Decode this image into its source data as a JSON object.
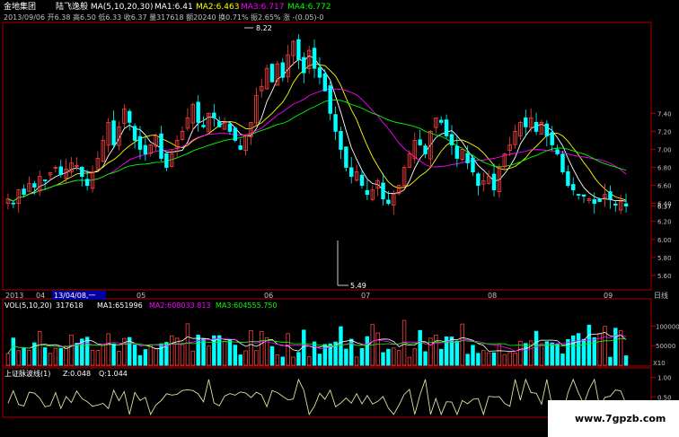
{
  "header": {
    "stock_name": "金地集团",
    "ma_label": "陆飞逸般 MA(5,10,20,30)",
    "ma1": "MA1:6.41",
    "ma2": "MA2:6.463",
    "ma3": "MA3:6.717",
    "ma4": "MA4:6.772",
    "info_line": "2013/09/06 开6.38 高6.50 低6.33 收6.37 量317618 额20240 换0.71% 振2.65% 涨 -(0.05)-0"
  },
  "price_labels": {
    "high": "8.22",
    "low": "5.49"
  },
  "x_axis": {
    "labels": [
      "2013",
      "04",
      "13/04/08,一",
      "05",
      "06",
      "07",
      "08",
      "09"
    ],
    "period": "日线"
  },
  "volume_panel": {
    "title": "VOL(5,10,20)",
    "value": "317618",
    "ma1": "MA1:651996",
    "ma2": "MA2:608033.813",
    "ma3": "MA3:604555.750",
    "unit": "X10"
  },
  "indicator_panel": {
    "title": "上证脉波线(1)",
    "z": "Z:0.048",
    "q": "Q:1.044"
  },
  "watermark": "www.7gpzb.com",
  "colors": {
    "background": "#000000",
    "up": "#ff4040",
    "down": "#00ffff",
    "ma1": "#ffffff",
    "ma2": "#ffff00",
    "ma3": "#ff00ff",
    "ma4": "#00ff00",
    "axis": "#b00000"
  },
  "chart_data": [
    {
      "type": "candlestick",
      "title": "",
      "y_ticks": [
        5.6,
        5.8,
        6.0,
        6.2,
        6.37,
        6.4,
        6.6,
        6.8,
        7.0,
        7.2,
        7.4
      ],
      "ylim": [
        5.45,
        8.4
      ],
      "close_series": [
        6.45,
        6.4,
        6.55,
        6.5,
        6.62,
        6.58,
        6.7,
        6.66,
        6.74,
        6.8,
        6.72,
        6.78,
        6.85,
        6.82,
        6.7,
        6.6,
        6.75,
        6.9,
        7.1,
        7.3,
        7.05,
        7.25,
        7.45,
        7.3,
        7.1,
        7.0,
        6.95,
        7.05,
        7.15,
        6.9,
        6.8,
        6.95,
        7.1,
        7.2,
        7.35,
        7.5,
        7.3,
        7.25,
        7.4,
        7.35,
        7.25,
        7.3,
        7.2,
        7.1,
        7.0,
        7.15,
        7.3,
        7.6,
        7.7,
        7.9,
        7.75,
        7.95,
        7.8,
        8.05,
        8.2,
        8.0,
        7.85,
        8.1,
        7.9,
        7.8,
        7.65,
        7.4,
        7.2,
        7.0,
        6.8,
        6.7,
        6.75,
        6.6,
        6.5,
        6.55,
        6.65,
        6.45,
        6.4,
        6.5,
        6.6,
        6.8,
        6.95,
        7.1,
        7.05,
        6.95,
        7.2,
        7.35,
        7.3,
        7.15,
        7.05,
        6.9,
        7.0,
        6.85,
        6.75,
        6.6,
        6.65,
        6.7,
        6.55,
        6.8,
        6.95,
        7.05,
        7.2,
        7.3,
        7.25,
        7.35,
        7.2,
        7.3,
        7.15,
        7.05,
        6.95,
        6.75,
        6.6,
        6.55,
        6.5,
        6.48,
        6.45,
        6.4,
        6.42,
        6.5,
        6.45,
        6.38,
        6.42,
        6.37
      ],
      "lines": [
        "MA1",
        "MA2",
        "MA3",
        "MA4"
      ]
    },
    {
      "type": "bar",
      "title": "",
      "y_ticks": [
        50000,
        100000
      ],
      "ylim": [
        0,
        140000
      ],
      "note": "volume bars, scaled x10"
    },
    {
      "type": "line",
      "title": "",
      "y_ticks": [
        0.5,
        1.0
      ],
      "ylim": [
        0,
        1.2
      ]
    }
  ]
}
